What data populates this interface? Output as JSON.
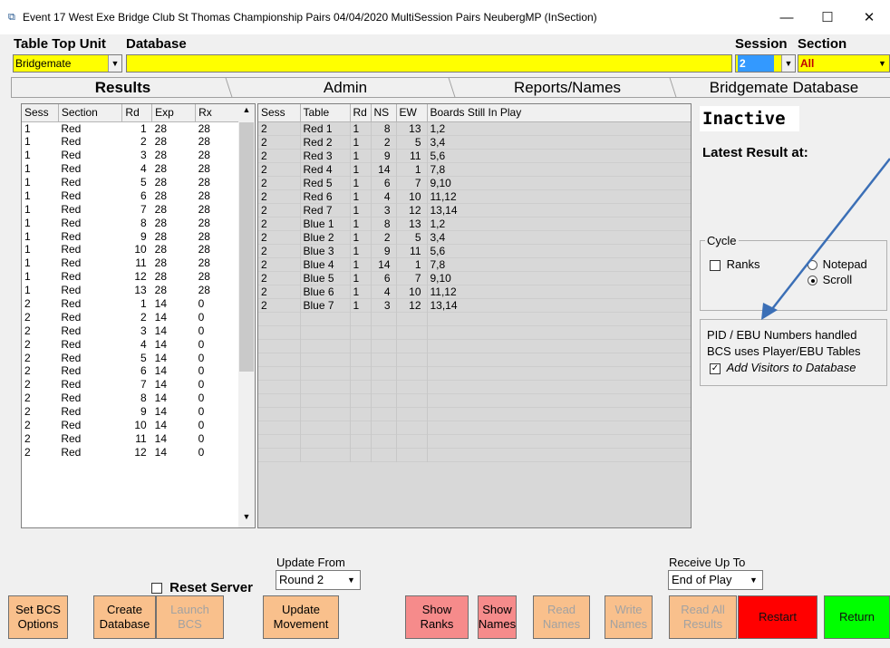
{
  "window": {
    "title": "Event 17  West Exe Bridge Club St Thomas Championship Pairs 04/04/2020 MultiSession Pairs NeubergMP (InSection)",
    "minimize": "—",
    "maximize": "☐",
    "close": "✕"
  },
  "header": {
    "table_top_unit_label": "Table Top Unit",
    "database_label": "Database",
    "table_top_unit_value": "Bridgemate",
    "database_value": "",
    "session_label": "Session",
    "section_label": "Section",
    "session_value": "2",
    "section_value": "All"
  },
  "tabs": [
    "Results",
    "Admin",
    "Reports/Names",
    "Bridgemate Database"
  ],
  "results_table": {
    "headers": [
      "Sess",
      "Section",
      "Rd",
      "Exp",
      "Rx"
    ],
    "rows": [
      [
        "1",
        "Red",
        "1",
        "28",
        "28"
      ],
      [
        "1",
        "Red",
        "2",
        "28",
        "28"
      ],
      [
        "1",
        "Red",
        "3",
        "28",
        "28"
      ],
      [
        "1",
        "Red",
        "4",
        "28",
        "28"
      ],
      [
        "1",
        "Red",
        "5",
        "28",
        "28"
      ],
      [
        "1",
        "Red",
        "6",
        "28",
        "28"
      ],
      [
        "1",
        "Red",
        "7",
        "28",
        "28"
      ],
      [
        "1",
        "Red",
        "8",
        "28",
        "28"
      ],
      [
        "1",
        "Red",
        "9",
        "28",
        "28"
      ],
      [
        "1",
        "Red",
        "10",
        "28",
        "28"
      ],
      [
        "1",
        "Red",
        "11",
        "28",
        "28"
      ],
      [
        "1",
        "Red",
        "12",
        "28",
        "28"
      ],
      [
        "1",
        "Red",
        "13",
        "28",
        "28"
      ],
      [
        "2",
        "Red",
        "1",
        "14",
        "0"
      ],
      [
        "2",
        "Red",
        "2",
        "14",
        "0"
      ],
      [
        "2",
        "Red",
        "3",
        "14",
        "0"
      ],
      [
        "2",
        "Red",
        "4",
        "14",
        "0"
      ],
      [
        "2",
        "Red",
        "5",
        "14",
        "0"
      ],
      [
        "2",
        "Red",
        "6",
        "14",
        "0"
      ],
      [
        "2",
        "Red",
        "7",
        "14",
        "0"
      ],
      [
        "2",
        "Red",
        "8",
        "14",
        "0"
      ],
      [
        "2",
        "Red",
        "9",
        "14",
        "0"
      ],
      [
        "2",
        "Red",
        "10",
        "14",
        "0"
      ],
      [
        "2",
        "Red",
        "11",
        "14",
        "0"
      ],
      [
        "2",
        "Red",
        "12",
        "14",
        "0"
      ]
    ]
  },
  "play_table": {
    "headers": [
      "Sess",
      "Table",
      "Rd",
      "NS",
      "EW",
      "Boards Still In Play"
    ],
    "rows": [
      [
        "2",
        "Red 1",
        "1",
        "8",
        "13",
        "1,2"
      ],
      [
        "2",
        "Red 2",
        "1",
        "2",
        "5",
        "3,4"
      ],
      [
        "2",
        "Red 3",
        "1",
        "9",
        "11",
        "5,6"
      ],
      [
        "2",
        "Red 4",
        "1",
        "14",
        "1",
        "7,8"
      ],
      [
        "2",
        "Red 5",
        "1",
        "6",
        "7",
        "9,10"
      ],
      [
        "2",
        "Red 6",
        "1",
        "4",
        "10",
        "11,12"
      ],
      [
        "2",
        "Red 7",
        "1",
        "3",
        "12",
        "13,14"
      ],
      [
        "2",
        "Blue 1",
        "1",
        "8",
        "13",
        "1,2"
      ],
      [
        "2",
        "Blue 2",
        "1",
        "2",
        "5",
        "3,4"
      ],
      [
        "2",
        "Blue 3",
        "1",
        "9",
        "11",
        "5,6"
      ],
      [
        "2",
        "Blue 4",
        "1",
        "14",
        "1",
        "7,8"
      ],
      [
        "2",
        "Blue 5",
        "1",
        "6",
        "7",
        "9,10"
      ],
      [
        "2",
        "Blue 6",
        "1",
        "4",
        "10",
        "11,12"
      ],
      [
        "2",
        "Blue 7",
        "1",
        "3",
        "12",
        "13,14"
      ]
    ]
  },
  "status": {
    "state": "Inactive",
    "latest_result_label": "Latest Result at:"
  },
  "cycle": {
    "legend": "Cycle",
    "ranks_label": "Ranks",
    "notepad_label": "Notepad",
    "scroll_label": "Scroll",
    "selected": "Scroll"
  },
  "pid_box": {
    "line1": "PID / EBU Numbers handled",
    "line2": "BCS uses Player/EBU Tables",
    "add_visitors_label": "Add Visitors to Database",
    "add_visitors_checked": true
  },
  "controls": {
    "update_from_label": "Update From",
    "update_from_value": "Round 2",
    "reset_server_label": "Reset Server",
    "receive_up_to_label": "Receive Up To",
    "receive_up_to_value": "End of Play"
  },
  "buttons": {
    "set_bcs_options": "Set BCS Options",
    "create_database": "Create Database",
    "launch_bcs": "Launch BCS",
    "update_movement": "Update Movement",
    "show_ranks": "Show Ranks",
    "show_names": "Show Names",
    "read_names": "Read Names",
    "write_names": "Write Names",
    "read_all_results": "Read All Results",
    "restart": "Restart",
    "return": "Return"
  },
  "colors": {
    "highlight_yellow": "#ffff00",
    "button_orange": "#f9c08c",
    "button_pink": "#f68b8b",
    "restart_red": "#ff0000",
    "return_green": "#00ff00",
    "arrow_blue": "#3b6fb6"
  }
}
